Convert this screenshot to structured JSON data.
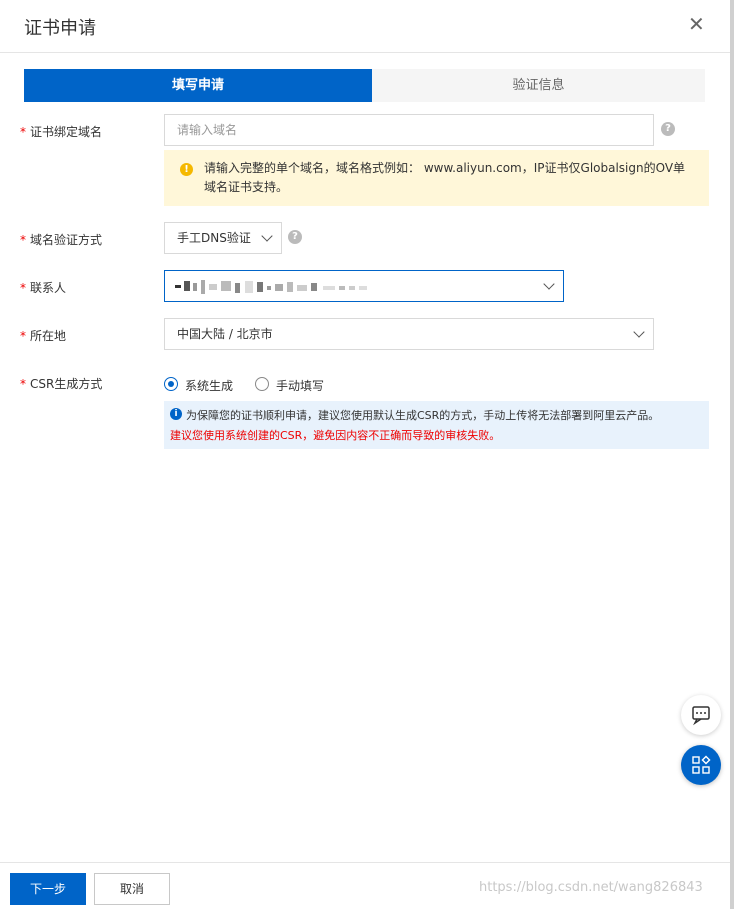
{
  "dialog": {
    "title": "证书申请",
    "close_symbol": "✕"
  },
  "steps": [
    {
      "label": "填写申请",
      "active": true
    },
    {
      "label": "验证信息",
      "active": false
    }
  ],
  "form": {
    "domain": {
      "label": "证书绑定域名",
      "placeholder": "请输入域名",
      "help": "?",
      "warning_icon": "!",
      "warning": "请输入完整的单个域名，域名格式例如： www.aliyun.com，IP证书仅Globalsign的OV单域名证书支持。"
    },
    "verify_method": {
      "label": "域名验证方式",
      "value": "手工DNS验证",
      "help": "?"
    },
    "contact": {
      "label": "联系人"
    },
    "location": {
      "label": "所在地",
      "value": "中国大陆 / 北京市"
    },
    "csr": {
      "label": "CSR生成方式",
      "options": [
        "系统生成",
        "手动填写"
      ],
      "selected_index": 0,
      "info_icon": "i",
      "info": "为保障您的证书顺利申请，建议您使用默认生成CSR的方式，手动上传将无法部署到阿里云产品。",
      "warning": "建议您使用系统创建的CSR，避免因内容不正确而导致的审核失败。"
    }
  },
  "footer": {
    "next_label": "下一步",
    "cancel_label": "取消",
    "watermark": "https://blog.csdn.net/wang826843"
  },
  "colors": {
    "primary": "#0064c8",
    "required": "#e00000",
    "warning_bg": "#fff7d9",
    "info_bg": "#e8f2fc"
  },
  "icons": {
    "close": "close-icon",
    "help": "help-icon",
    "warning": "warning-icon",
    "info": "info-icon",
    "chat": "chat-icon",
    "apps": "apps-icon",
    "dropdown": "chevron-down-icon"
  }
}
